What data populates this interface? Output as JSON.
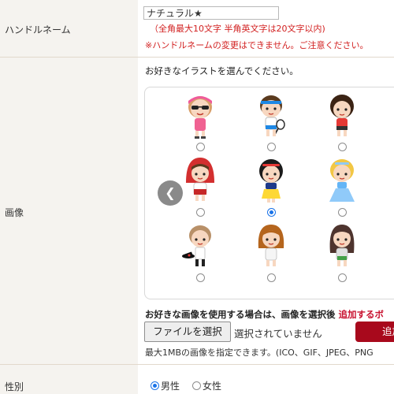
{
  "labels": {
    "handle": "ハンドルネーム",
    "image": "画像",
    "gender": "性別"
  },
  "handle": {
    "value": "ナチュラル★",
    "limit_note": "（全角最大10文字 半角英文字は20文字以内)",
    "change_note": "※ハンドルネームの変更はできません。ご注意ください。"
  },
  "image": {
    "instruction": "お好きなイラストを選んでください。",
    "prev_icon": "chevron-left-icon",
    "avatars": [
      {
        "name": "avatar-sunglasses-icon",
        "selected": false
      },
      {
        "name": "avatar-tennis-icon",
        "selected": false
      },
      {
        "name": "avatar-curly-hair-icon",
        "selected": false
      },
      {
        "name": "avatar-red-riding-hood-icon",
        "selected": false
      },
      {
        "name": "avatar-snow-white-icon",
        "selected": true
      },
      {
        "name": "avatar-cinderella-icon",
        "selected": false
      },
      {
        "name": "avatar-magician-icon",
        "selected": false
      },
      {
        "name": "avatar-brown-hair-icon",
        "selected": false
      },
      {
        "name": "avatar-long-hair-icon",
        "selected": false
      }
    ],
    "custom_note": "お好きな画像を使用する場合は、画像を選択後 ",
    "custom_note_link": "追加するボ",
    "file_button": "ファイルを選択",
    "file_status": "選択されていません",
    "add_button": "追加",
    "size_note": "最大1MBの画像を指定できます。(ICO、GIF、JPEG、PNG"
  },
  "gender": {
    "options": [
      {
        "label": "男性",
        "selected": true
      },
      {
        "label": "女性",
        "selected": false
      }
    ]
  },
  "colors": {
    "label_bg": "#f5f3ef",
    "note_red": "#d22020",
    "add_button": "#a8091c",
    "radio_selected": "#1a73e8"
  }
}
